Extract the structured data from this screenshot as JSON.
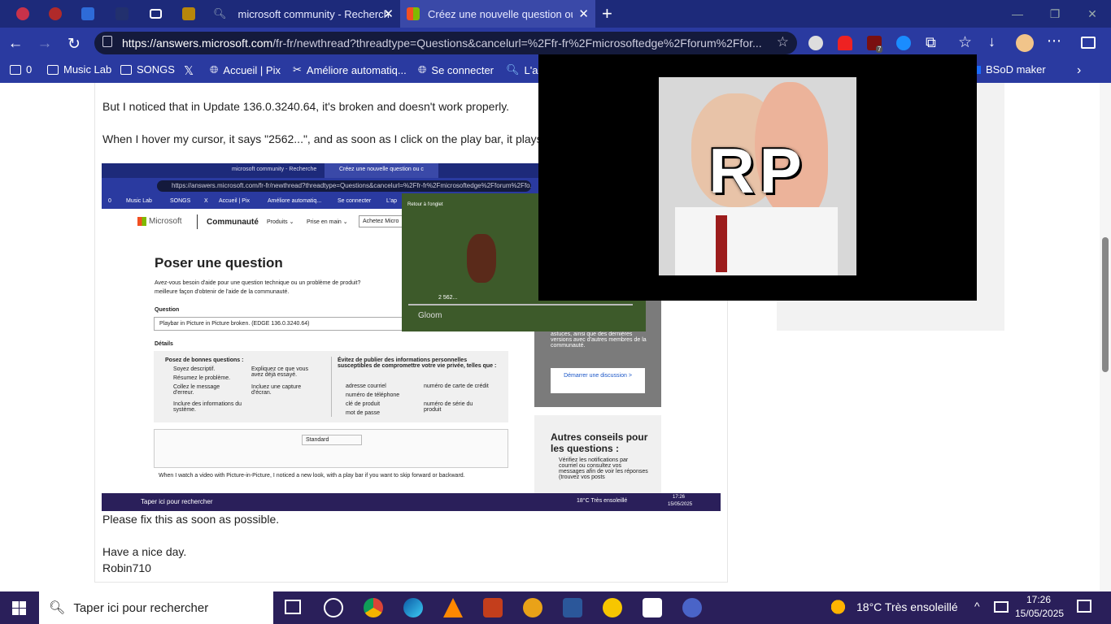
{
  "tabs": [
    {
      "title": "",
      "icon": "game-icon"
    },
    {
      "title": "",
      "icon": "clown-icon"
    },
    {
      "title": "",
      "icon": "co-icon"
    },
    {
      "title": "",
      "icon": "game-icon"
    },
    {
      "title": "",
      "icon": "media-icon"
    },
    {
      "title": "",
      "icon": "game-icon"
    },
    {
      "title": "microsoft community - Recherche",
      "icon": "search-icon"
    },
    {
      "title": "Créez une nouvelle question ou c",
      "icon": "microsoft-icon"
    }
  ],
  "new_tab_symbol": "+",
  "window_controls": {
    "minimize": "—",
    "restore": "❐",
    "close": "✕"
  },
  "address": {
    "host": "https://answers.microsoft.com",
    "path": "/fr-fr/newthread?threadtype=Questions&cancelurl=%2Ffr-fr%2Fmicrosoftedge%2Fforum%2Ffor..."
  },
  "extension_badge": "7",
  "bookmarks": [
    {
      "label": "0"
    },
    {
      "label": "Music Lab"
    },
    {
      "label": "SONGS"
    },
    {
      "label": ""
    },
    {
      "label": "Accueil | Pix"
    },
    {
      "label": "Améliore automatiq..."
    },
    {
      "label": "Se connecter"
    },
    {
      "label": "L'ap"
    },
    {
      "label": "BSoD maker"
    }
  ],
  "post": {
    "line1": "But I noticed that in Update 136.0.3240.64, it's broken and doesn't work properly.",
    "line2": "When I hover my cursor, it says \"2562...\", and as soon as I click on the play bar, it plays t",
    "line3": "Please fix this as soon as possible.",
    "line4": "Have a nice day.",
    "line5": "Robin710"
  },
  "shot": {
    "tab1": "microsoft community - Recherche",
    "tab2": "Créez une nouvelle question ou c",
    "url": "https://answers.microsoft.com/fr-fr/newthread?threadtype=Questions&cancelurl=%2Ffr-fr%2Fmicrosoftedge%2Fforum%2Ffo...",
    "bookmarks": [
      "0",
      "Music Lab",
      "SONGS",
      "X",
      "Accueil | Pix",
      "Améliore automatiq...",
      "Se connecter",
      "L'ap"
    ],
    "brand": "Microsoft",
    "community": "Communauté",
    "menu1": "Produits ⌄",
    "menu2": "Prise en main ⌄",
    "menu3": "Achetez Micro",
    "heading": "Poser une question",
    "intro1": "Avez-vous besoin d'aide pour une question technique ou un problème de produit?",
    "intro2": "meilleure façon d'obtenir de l'aide de la communauté.",
    "question_label": "Question",
    "question_value": "Playbar in Picture in Picture broken. (EDGE 136.0.3240.64)",
    "details_label": "Détails",
    "good_title": "Posez de bonnes questions :",
    "good_items": [
      "Soyez descriptif.",
      "Résumez le problème.",
      "Collez le message d'erreur.",
      "Inclure des informations du système."
    ],
    "good_items2": [
      "Expliquez ce que vous avez déjà essayé.",
      "Incluez une capture d'écran."
    ],
    "avoid_title": "Évitez de publier des informations personnelles susceptibles de compromettre votre vie privée, telles que :",
    "avoid_items": [
      "adresse courriel",
      "numéro de téléphone",
      "clé de produit",
      "mot de passe"
    ],
    "avoid_items2": [
      "numéro de carte de crédit",
      "numéro de série du produit"
    ],
    "editor_style": "Standard",
    "editor_text": "When I watch a video with Picture-in-Picture, I noticed a new look, with a play bar if you want to skip forward or backward.",
    "side1_text": "astuces, ainsi que des dernières versions avec d'autres membres de la communauté.",
    "side_button": "Démarrer une discussion >",
    "side2_title": "Autres conseils pour les questions :",
    "side2_text": "Vérifiez les notifications par courriel ou consultez vos messages afin de voir les réponses (trouvez vos posts",
    "video_back": "Retour à l'onglet",
    "video_time": "2 562...",
    "video_title": "Gloom",
    "taskbar_search": "Taper ici pour rechercher",
    "weather": "18°C  Très ensoleillé",
    "time": "17:26",
    "date": "15/05/2025"
  },
  "pip": {
    "overlay_text": "RP"
  },
  "taskbar": {
    "search_placeholder": "Taper ici pour rechercher",
    "weather": "18°C  Très ensoleillé",
    "time": "17:26",
    "date": "15/05/2025"
  }
}
